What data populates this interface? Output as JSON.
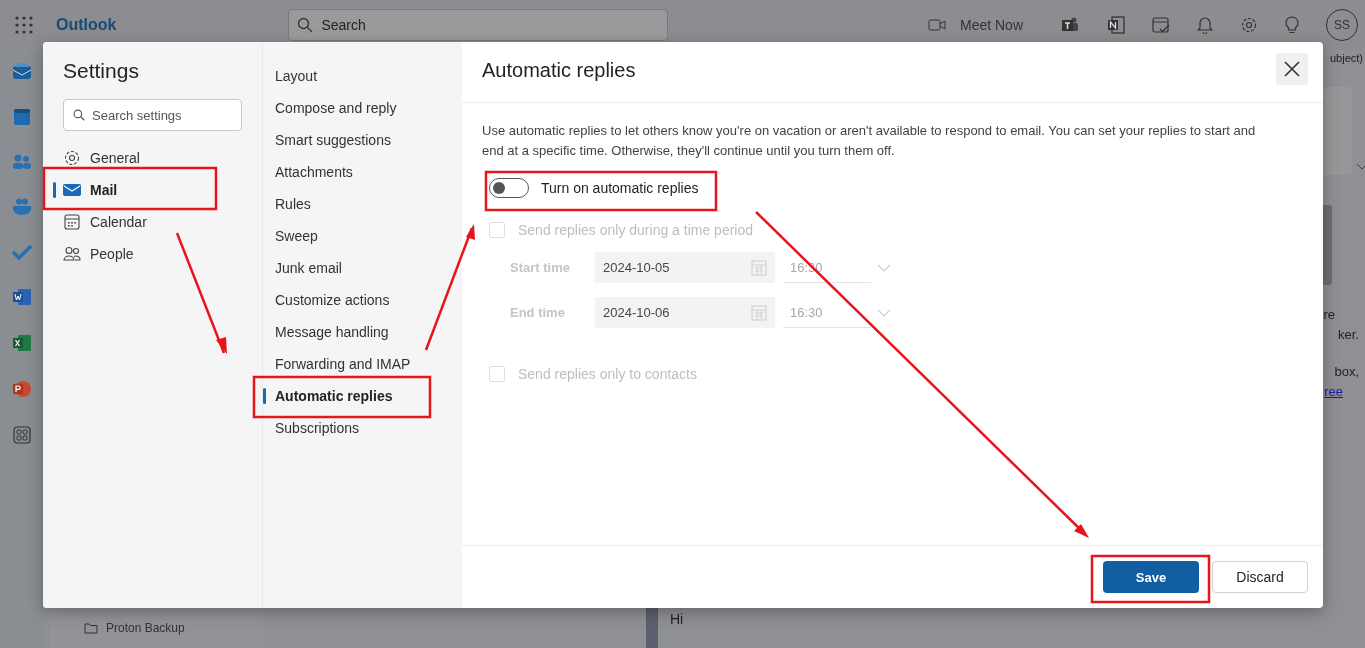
{
  "app": {
    "name": "Outlook",
    "search_placeholder": "Search",
    "meet_now": "Meet Now",
    "avatar": "SS"
  },
  "background": {
    "subject_fragment": "ubject)",
    "text_fragments": [
      "re",
      "ker.",
      "box,"
    ],
    "link_fragment": "ree",
    "folder": "Proton Backup",
    "message_fragment": "Hi"
  },
  "settings": {
    "title": "Settings",
    "search_placeholder": "Search settings",
    "categories": [
      {
        "label": "General",
        "selected": false
      },
      {
        "label": "Mail",
        "selected": true
      },
      {
        "label": "Calendar",
        "selected": false
      },
      {
        "label": "People",
        "selected": false
      }
    ],
    "subcategories": [
      {
        "label": "Layout",
        "selected": false
      },
      {
        "label": "Compose and reply",
        "selected": false
      },
      {
        "label": "Smart suggestions",
        "selected": false
      },
      {
        "label": "Attachments",
        "selected": false
      },
      {
        "label": "Rules",
        "selected": false
      },
      {
        "label": "Sweep",
        "selected": false
      },
      {
        "label": "Junk email",
        "selected": false
      },
      {
        "label": "Customize actions",
        "selected": false
      },
      {
        "label": "Message handling",
        "selected": false
      },
      {
        "label": "Forwarding and IMAP",
        "selected": false
      },
      {
        "label": "Automatic replies",
        "selected": true
      },
      {
        "label": "Subscriptions",
        "selected": false
      }
    ]
  },
  "panel": {
    "title": "Automatic replies",
    "description": "Use automatic replies to let others know you're on vacation or aren't available to respond to email. You can set your replies to start and end at a specific time. Otherwise, they'll continue until you turn them off.",
    "toggle": {
      "label": "Turn on automatic replies",
      "on": false
    },
    "time_period": {
      "label": "Send replies only during a time period",
      "checked": false,
      "disabled": true
    },
    "times": [
      {
        "label": "Start time",
        "date": "2024-10-05",
        "time": "16:30"
      },
      {
        "label": "End time",
        "date": "2024-10-06",
        "time": "16:30"
      }
    ],
    "contacts_only": {
      "label": "Send replies only to contacts",
      "checked": false,
      "disabled": true
    }
  },
  "buttons": {
    "save": "Save",
    "discard": "Discard"
  }
}
